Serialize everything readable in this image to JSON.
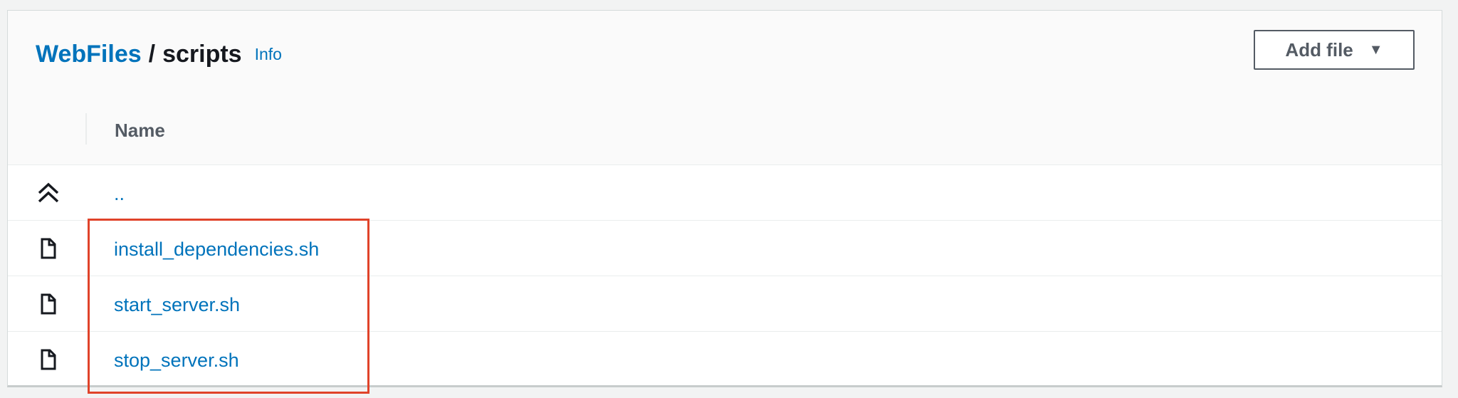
{
  "breadcrumb": {
    "root": "WebFiles",
    "separator": "/",
    "current": "scripts",
    "info": "Info"
  },
  "toolbar": {
    "add_file_label": "Add file"
  },
  "table": {
    "column_name": "Name",
    "rows": [
      {
        "label": "..",
        "icon": "parent-folder-icon"
      },
      {
        "label": "install_dependencies.sh",
        "icon": "file-icon"
      },
      {
        "label": "start_server.sh",
        "icon": "file-icon"
      },
      {
        "label": "stop_server.sh",
        "icon": "file-icon"
      }
    ]
  },
  "colors": {
    "link": "#0073bb",
    "text": "#16191f",
    "highlight": "#e0432a"
  }
}
